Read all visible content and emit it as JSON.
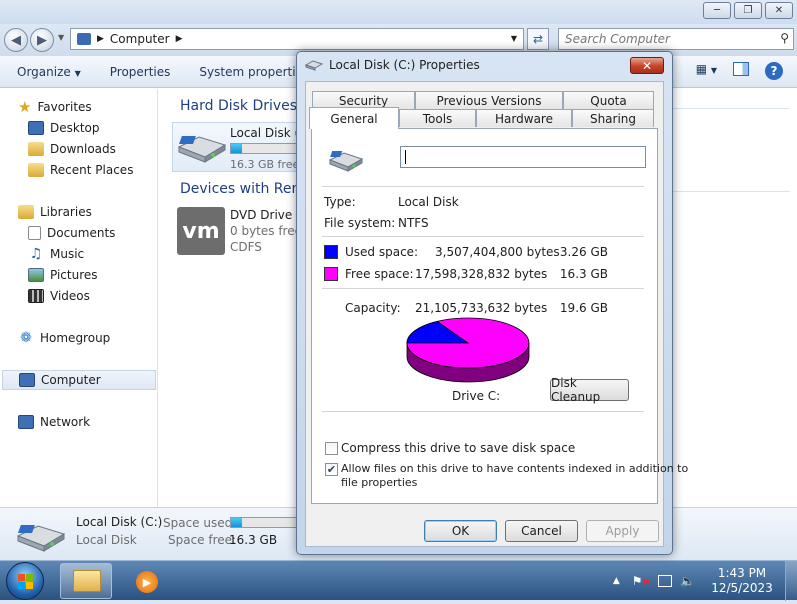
{
  "explorer": {
    "address": "Computer",
    "search_placeholder": "Search Computer",
    "toolbar": {
      "organize": "Organize",
      "properties": "Properties",
      "system_properties": "System properties"
    },
    "nav": {
      "favorites": "Favorites",
      "desktop": "Desktop",
      "downloads": "Downloads",
      "recent_places": "Recent Places",
      "libraries": "Libraries",
      "documents": "Documents",
      "music": "Music",
      "pictures": "Pictures",
      "videos": "Videos",
      "homegroup": "Homegroup",
      "computer": "Computer",
      "network": "Network"
    },
    "groups": {
      "hard_disk_drives": "Hard Disk Drives (",
      "devices_with_removable": "Devices with Rem"
    },
    "local_disk": {
      "name": "Local Disk (C",
      "free": "16.3 GB free",
      "used_fraction": 0.166
    },
    "dvd_drive": {
      "name": "DVD Drive (D",
      "free": "0 bytes free o",
      "fs": "CDFS",
      "logo_text": "vm"
    },
    "details": {
      "name": "Local Disk (C:)",
      "type": "Local Disk",
      "space_used_label": "Space used:",
      "space_free_label": "Space free:",
      "space_free_value": "16.3 GB",
      "used_fraction": 0.166
    }
  },
  "taskbar": {
    "time": "1:43 PM",
    "date": "12/5/2023"
  },
  "dialog": {
    "title": "Local Disk (C:) Properties",
    "tabs": {
      "security": "Security",
      "previous_versions": "Previous Versions",
      "quota": "Quota",
      "general": "General",
      "tools": "Tools",
      "hardware": "Hardware",
      "sharing": "Sharing"
    },
    "name_value": "",
    "type_label": "Type:",
    "type_value": "Local Disk",
    "fs_label": "File system:",
    "fs_value": "NTFS",
    "used_label": "Used space:",
    "used_bytes": "3,507,404,800 bytes",
    "used_gb": "3.26 GB",
    "free_label": "Free space:",
    "free_bytes": "17,598,328,832 bytes",
    "free_gb": "16.3 GB",
    "capacity_label": "Capacity:",
    "capacity_bytes": "21,105,733,632 bytes",
    "capacity_gb": "19.6 GB",
    "used_fraction": 0.166,
    "used_color": "#0000ff",
    "free_color": "#ff00ff",
    "drive_label": "Drive C:",
    "disk_cleanup": "Disk Cleanup",
    "compress_label": "Compress this drive to save disk space",
    "compress_checked": false,
    "index_label_1": "Allow files on this drive to have contents indexed in addition to",
    "index_label_2": "file properties",
    "index_checked": true,
    "ok": "OK",
    "cancel": "Cancel",
    "apply": "Apply"
  }
}
